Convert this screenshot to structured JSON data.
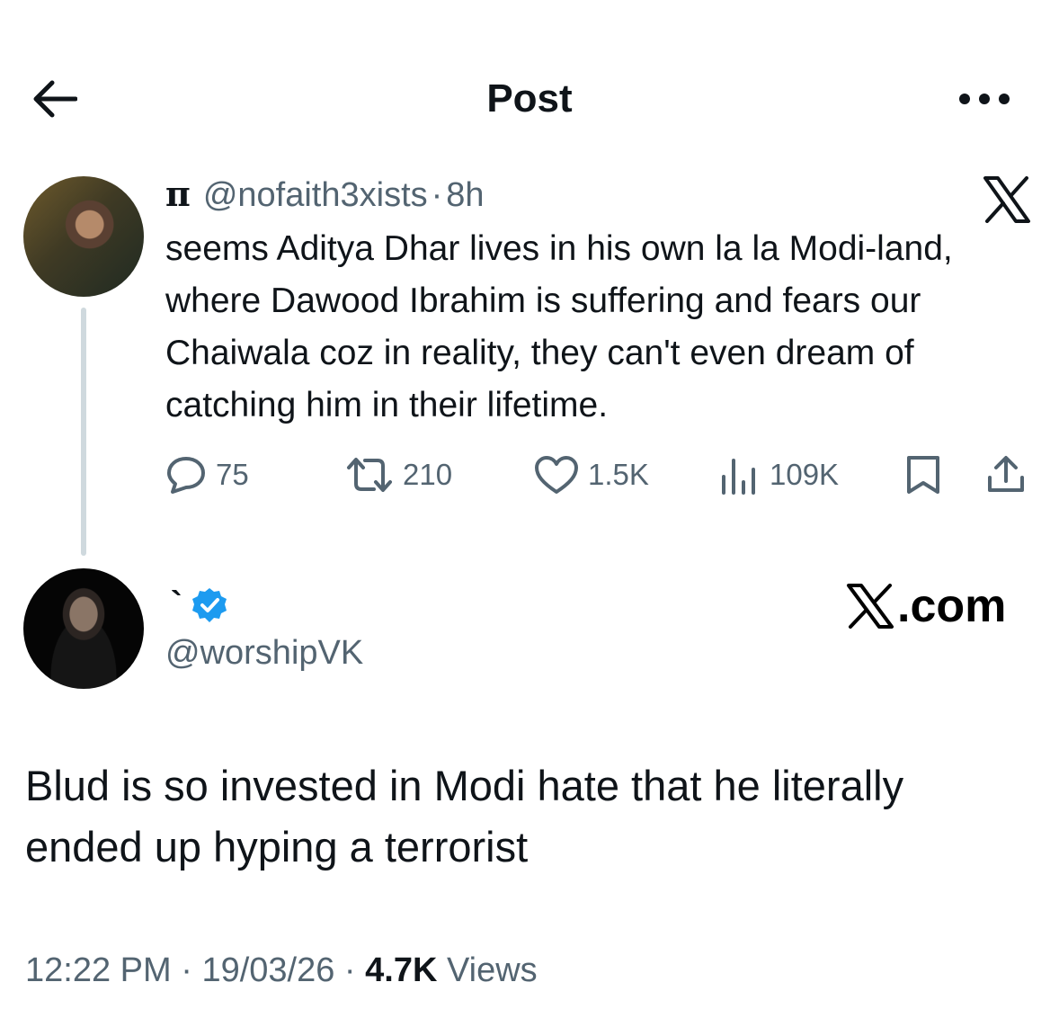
{
  "header": {
    "title": "Post",
    "back_icon": "arrow-left-icon",
    "more_icon": "more-dots-icon"
  },
  "quoted_tweet": {
    "name": "π",
    "handle": "@nofaith3xists",
    "separator": "·",
    "time": "8h",
    "text": "seems Aditya Dhar lives in his own la la Modi-land, where Dawood Ibrahim is suffering and fears our Chaiwala coz in reality, they can't even dream of catching him in their lifetime.",
    "stats": {
      "replies": "75",
      "reposts": "210",
      "likes": "1.5K",
      "views": "109K"
    },
    "brand_icon": "x-logo-icon"
  },
  "reply_tweet": {
    "name": "`",
    "handle": "@worshipVK",
    "verified_icon": "verified-badge-icon",
    "brand_label": ".com",
    "text": "Blud is so invested in Modi hate that he literally ended up hyping a terrorist",
    "time": "12:22 PM",
    "date": "19/03/26",
    "separator": "·",
    "views_count": "4.7K",
    "views_label": "Views"
  },
  "colors": {
    "text": "#0f1419",
    "secondary": "#536471",
    "verified": "#1d9bf0",
    "thread_line": "#cfd9de"
  }
}
